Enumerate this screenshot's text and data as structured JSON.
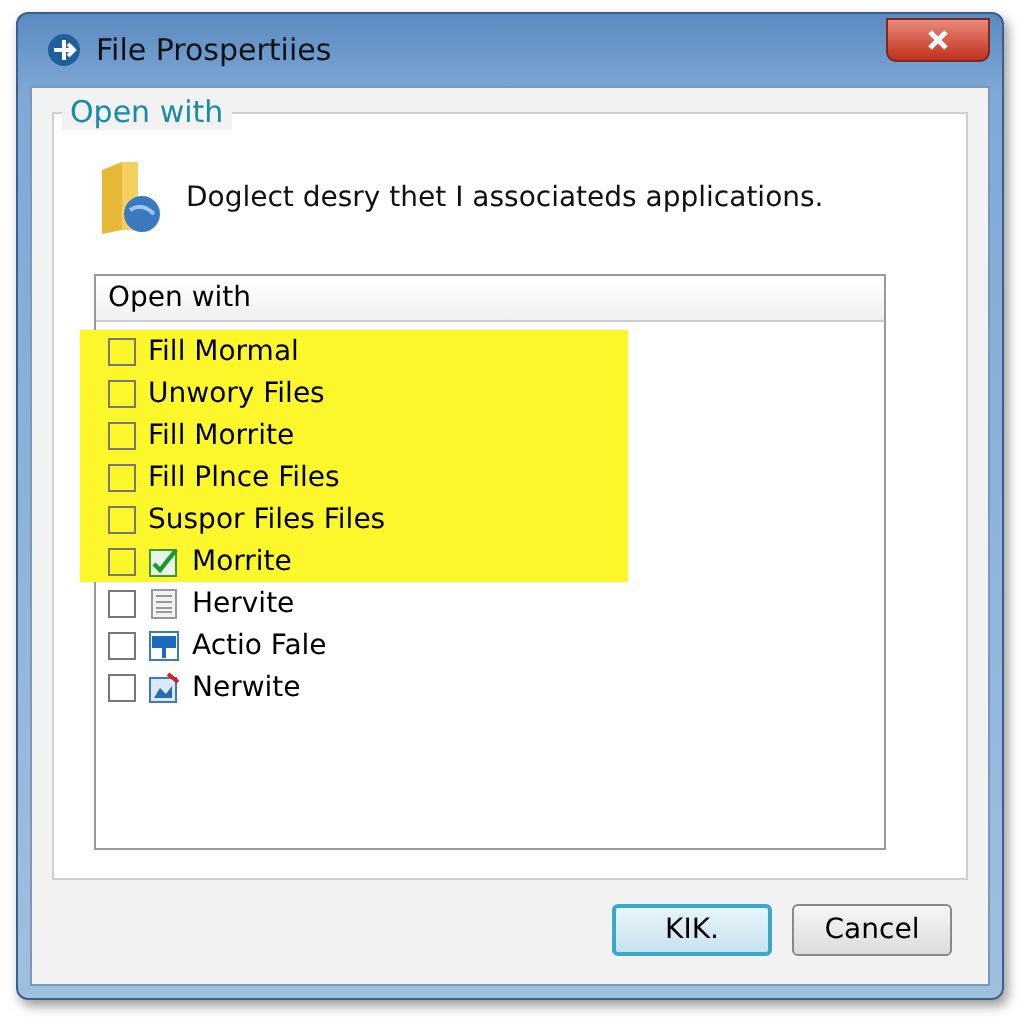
{
  "window": {
    "title": "File Prospertiies"
  },
  "group": {
    "title": "Open with",
    "description": "Doglect desry thet I associateds applications."
  },
  "list": {
    "header": "Open with",
    "items": [
      {
        "label": "Fill Mormal",
        "checked": false,
        "highlighted": true
      },
      {
        "label": "Unwory Files",
        "checked": false,
        "highlighted": true
      },
      {
        "label": "Fill Morrite",
        "checked": false,
        "highlighted": true
      },
      {
        "label": "Fill Plnce Files",
        "checked": false,
        "highlighted": true
      },
      {
        "label": "Suspor Files Files",
        "checked": false,
        "highlighted": true
      },
      {
        "label": "Morrite",
        "checked": false,
        "highlighted": true,
        "kind": "check"
      },
      {
        "label": "Hervite",
        "checked": false,
        "highlighted": false,
        "kind": "document"
      },
      {
        "label": "Actio Fale",
        "checked": false,
        "highlighted": false,
        "kind": "tool"
      },
      {
        "label": "Nerwite",
        "checked": false,
        "highlighted": false,
        "kind": "image"
      }
    ]
  },
  "buttons": [
    {
      "label": "KIK.",
      "default": true
    },
    {
      "label": "Cancel",
      "default": false
    }
  ]
}
